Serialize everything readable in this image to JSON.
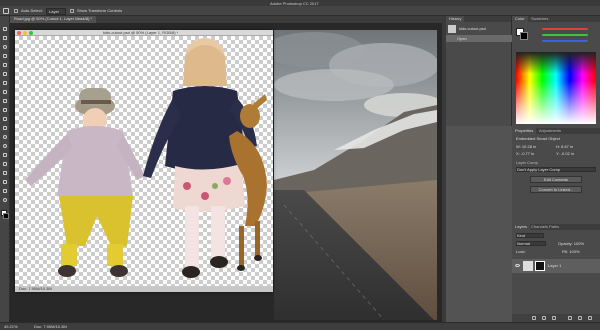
{
  "app": {
    "window_title": "Adobe Photoshop CC 2017"
  },
  "options_bar": {
    "auto_select_label": "Auto-Select:",
    "auto_select_value": "Layer",
    "show_transform_label": "Show Transform Controls"
  },
  "doc_tabs": [
    {
      "label": "Road.jpg @ 50% (Cutout 1, Layer Mask/8) *"
    }
  ],
  "cutout_window": {
    "title": "kids-cutout.psd @ 50% (Layer 1, RGB/8) *",
    "status": "Doc: 7.90M/10.3M"
  },
  "history_panel": {
    "tabs": [
      "History"
    ],
    "snapshot": "kids-cutout.psd",
    "items": [
      "Open"
    ]
  },
  "color_panel": {
    "tabs": [
      "Color",
      "Swatches"
    ],
    "slider_colors": [
      "#e04040",
      "#40c040",
      "#4060e0"
    ]
  },
  "properties_panel": {
    "tabs": [
      "Properties",
      "Adjustments"
    ],
    "heading": "Embedded Smart Object",
    "w": "W: 10.28 in",
    "h": "H: 8.67 in",
    "x": "X: -0.77 in",
    "y": "Y: -0.02 in",
    "comp_label": "Layer Comp",
    "comp_value": "Don't Apply Layer Comp",
    "edit_button": "Edit Contents",
    "convert_button": "Convert to Linked..."
  },
  "layers_panel": {
    "tabs": [
      "Layers",
      "Channels",
      "Paths"
    ],
    "kind_label": "Kind",
    "blend_mode": "Normal",
    "opacity": "Opacity: 100%",
    "lock_label": "Lock:",
    "fill": "Fill: 100%",
    "layers": [
      {
        "name": "Layer 1"
      }
    ]
  },
  "status_bar": {
    "zoom": "49.21%",
    "doc_info": "Doc: 7.90M/10.3M"
  },
  "colors": {
    "accent_red": "#ff5f57",
    "accent_yellow": "#febc2e",
    "accent_green": "#28c840"
  }
}
